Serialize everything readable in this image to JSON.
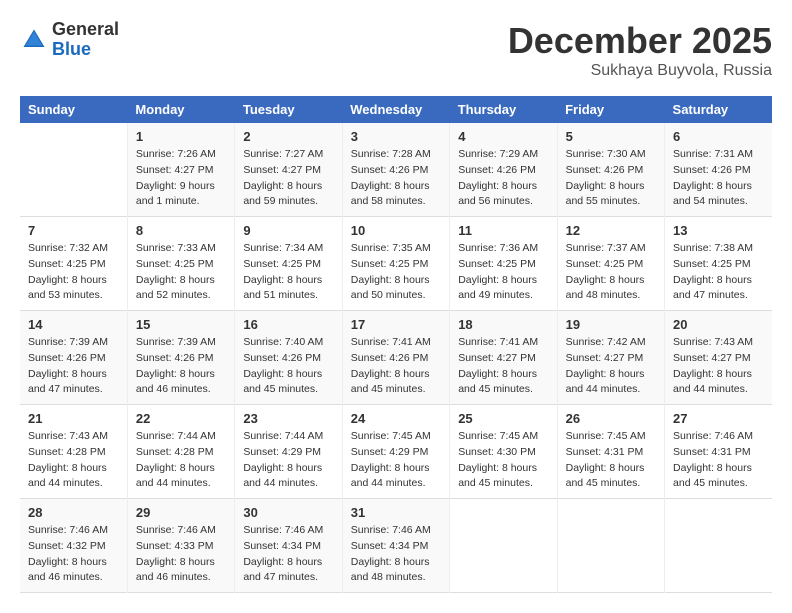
{
  "header": {
    "logo_general": "General",
    "logo_blue": "Blue",
    "month": "December 2025",
    "location": "Sukhaya Buyvola, Russia"
  },
  "days_of_week": [
    "Sunday",
    "Monday",
    "Tuesday",
    "Wednesday",
    "Thursday",
    "Friday",
    "Saturday"
  ],
  "weeks": [
    [
      {
        "day": "",
        "info": ""
      },
      {
        "day": "1",
        "info": "Sunrise: 7:26 AM\nSunset: 4:27 PM\nDaylight: 9 hours\nand 1 minute."
      },
      {
        "day": "2",
        "info": "Sunrise: 7:27 AM\nSunset: 4:27 PM\nDaylight: 8 hours\nand 59 minutes."
      },
      {
        "day": "3",
        "info": "Sunrise: 7:28 AM\nSunset: 4:26 PM\nDaylight: 8 hours\nand 58 minutes."
      },
      {
        "day": "4",
        "info": "Sunrise: 7:29 AM\nSunset: 4:26 PM\nDaylight: 8 hours\nand 56 minutes."
      },
      {
        "day": "5",
        "info": "Sunrise: 7:30 AM\nSunset: 4:26 PM\nDaylight: 8 hours\nand 55 minutes."
      },
      {
        "day": "6",
        "info": "Sunrise: 7:31 AM\nSunset: 4:26 PM\nDaylight: 8 hours\nand 54 minutes."
      }
    ],
    [
      {
        "day": "7",
        "info": "Sunrise: 7:32 AM\nSunset: 4:25 PM\nDaylight: 8 hours\nand 53 minutes."
      },
      {
        "day": "8",
        "info": "Sunrise: 7:33 AM\nSunset: 4:25 PM\nDaylight: 8 hours\nand 52 minutes."
      },
      {
        "day": "9",
        "info": "Sunrise: 7:34 AM\nSunset: 4:25 PM\nDaylight: 8 hours\nand 51 minutes."
      },
      {
        "day": "10",
        "info": "Sunrise: 7:35 AM\nSunset: 4:25 PM\nDaylight: 8 hours\nand 50 minutes."
      },
      {
        "day": "11",
        "info": "Sunrise: 7:36 AM\nSunset: 4:25 PM\nDaylight: 8 hours\nand 49 minutes."
      },
      {
        "day": "12",
        "info": "Sunrise: 7:37 AM\nSunset: 4:25 PM\nDaylight: 8 hours\nand 48 minutes."
      },
      {
        "day": "13",
        "info": "Sunrise: 7:38 AM\nSunset: 4:25 PM\nDaylight: 8 hours\nand 47 minutes."
      }
    ],
    [
      {
        "day": "14",
        "info": "Sunrise: 7:39 AM\nSunset: 4:26 PM\nDaylight: 8 hours\nand 47 minutes."
      },
      {
        "day": "15",
        "info": "Sunrise: 7:39 AM\nSunset: 4:26 PM\nDaylight: 8 hours\nand 46 minutes."
      },
      {
        "day": "16",
        "info": "Sunrise: 7:40 AM\nSunset: 4:26 PM\nDaylight: 8 hours\nand 45 minutes."
      },
      {
        "day": "17",
        "info": "Sunrise: 7:41 AM\nSunset: 4:26 PM\nDaylight: 8 hours\nand 45 minutes."
      },
      {
        "day": "18",
        "info": "Sunrise: 7:41 AM\nSunset: 4:27 PM\nDaylight: 8 hours\nand 45 minutes."
      },
      {
        "day": "19",
        "info": "Sunrise: 7:42 AM\nSunset: 4:27 PM\nDaylight: 8 hours\nand 44 minutes."
      },
      {
        "day": "20",
        "info": "Sunrise: 7:43 AM\nSunset: 4:27 PM\nDaylight: 8 hours\nand 44 minutes."
      }
    ],
    [
      {
        "day": "21",
        "info": "Sunrise: 7:43 AM\nSunset: 4:28 PM\nDaylight: 8 hours\nand 44 minutes."
      },
      {
        "day": "22",
        "info": "Sunrise: 7:44 AM\nSunset: 4:28 PM\nDaylight: 8 hours\nand 44 minutes."
      },
      {
        "day": "23",
        "info": "Sunrise: 7:44 AM\nSunset: 4:29 PM\nDaylight: 8 hours\nand 44 minutes."
      },
      {
        "day": "24",
        "info": "Sunrise: 7:45 AM\nSunset: 4:29 PM\nDaylight: 8 hours\nand 44 minutes."
      },
      {
        "day": "25",
        "info": "Sunrise: 7:45 AM\nSunset: 4:30 PM\nDaylight: 8 hours\nand 45 minutes."
      },
      {
        "day": "26",
        "info": "Sunrise: 7:45 AM\nSunset: 4:31 PM\nDaylight: 8 hours\nand 45 minutes."
      },
      {
        "day": "27",
        "info": "Sunrise: 7:46 AM\nSunset: 4:31 PM\nDaylight: 8 hours\nand 45 minutes."
      }
    ],
    [
      {
        "day": "28",
        "info": "Sunrise: 7:46 AM\nSunset: 4:32 PM\nDaylight: 8 hours\nand 46 minutes."
      },
      {
        "day": "29",
        "info": "Sunrise: 7:46 AM\nSunset: 4:33 PM\nDaylight: 8 hours\nand 46 minutes."
      },
      {
        "day": "30",
        "info": "Sunrise: 7:46 AM\nSunset: 4:34 PM\nDaylight: 8 hours\nand 47 minutes."
      },
      {
        "day": "31",
        "info": "Sunrise: 7:46 AM\nSunset: 4:34 PM\nDaylight: 8 hours\nand 48 minutes."
      },
      {
        "day": "",
        "info": ""
      },
      {
        "day": "",
        "info": ""
      },
      {
        "day": "",
        "info": ""
      }
    ]
  ]
}
